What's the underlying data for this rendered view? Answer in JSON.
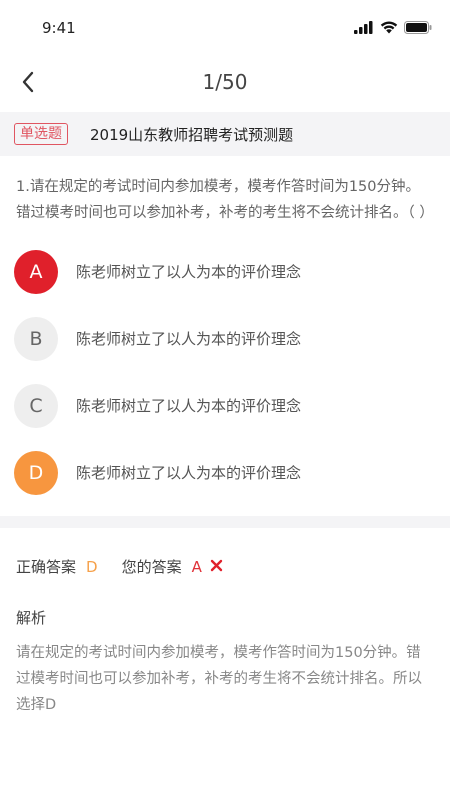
{
  "status": {
    "time": "9:41",
    "icons": [
      "signal-icon",
      "wifi-icon",
      "battery-icon"
    ]
  },
  "nav": {
    "back_icon": "chevron-left-icon",
    "counter": "1/50"
  },
  "question": {
    "type_badge": "单选题",
    "exam_title": "2019山东教师招聘考试预测题",
    "text": "1.请在规定的考试时间内参加模考，模考作答时间为150分钟。错过模考时间也可以参加补考，补考的考生将不会统计排名。（ ）"
  },
  "options": [
    {
      "letter": "A",
      "text": "陈老师树立了以人为本的评价理念",
      "state": "selected-wrong",
      "bg": "#e0202b",
      "fg": "#ffffff"
    },
    {
      "letter": "B",
      "text": "陈老师树立了以人为本的评价理念",
      "state": "normal",
      "bg": "#eeeeee",
      "fg": "#666666"
    },
    {
      "letter": "C",
      "text": "陈老师树立了以人为本的评价理念",
      "state": "normal",
      "bg": "#eeeeee",
      "fg": "#666666"
    },
    {
      "letter": "D",
      "text": "陈老师树立了以人为本的评价理念",
      "state": "correct",
      "bg": "#f7963f",
      "fg": "#ffffff"
    }
  ],
  "result": {
    "correct_label": "正确答案",
    "correct_value": "D",
    "yours_label": "您的答案",
    "yours_value": "A",
    "wrong_icon": "cross-icon"
  },
  "analysis": {
    "title": "解析",
    "text": "请在规定的考试时间内参加模考，模考作答时间为150分钟。错过模考时间也可以参加补考，补考的考生将不会统计排名。所以选择D"
  },
  "colors": {
    "accent_red": "#e0202b",
    "accent_orange": "#f7963f",
    "badge_red": "#e05561"
  }
}
